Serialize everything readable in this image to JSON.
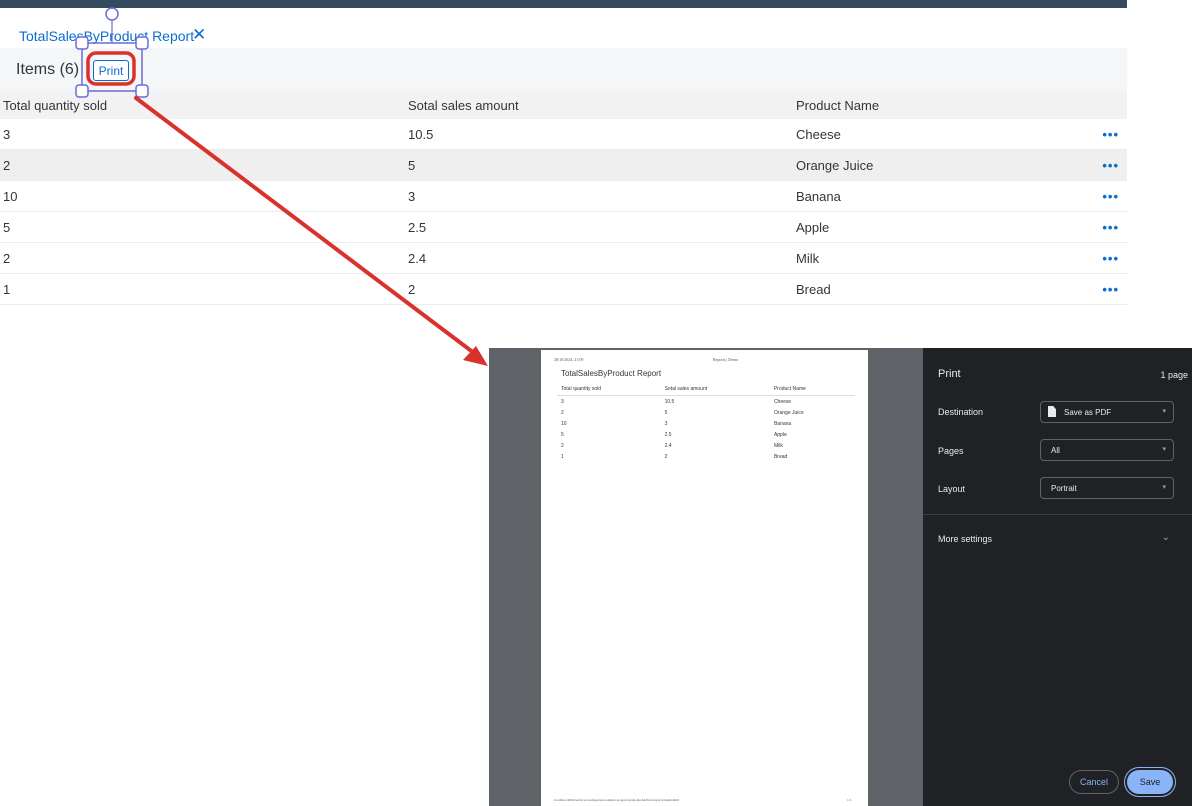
{
  "app": {
    "tab": {
      "label": "TotalSalesByProduct Report",
      "close_icon": "close-icon"
    },
    "toolbar": {
      "items_title": "Items (6)",
      "print_label": "Print"
    },
    "table": {
      "headers": [
        "Total quantity sold",
        "Sotal sales amount",
        "Product Name"
      ],
      "rows": [
        [
          "3",
          "10.5",
          "Cheese"
        ],
        [
          "2",
          "5",
          "Orange Juice"
        ],
        [
          "10",
          "3",
          "Banana"
        ],
        [
          "5",
          "2.5",
          "Apple"
        ],
        [
          "2",
          "2.4",
          "Milk"
        ],
        [
          "1",
          "2",
          "Bread"
        ]
      ],
      "row_action_icon": "more-horizontal-icon",
      "row_action_glyph": "•••"
    },
    "colors": {
      "shell": "#354a5f",
      "accent": "#0a6ed1",
      "annotation": "#d9322c"
    }
  },
  "print_preview": {
    "header_left": "28/10/2024, 21:09",
    "header_center": "Reports | Demo",
    "title": "TotalSalesByProduct Report",
    "headers": [
      "Total quantity sold",
      "Sotal sales amount",
      "Product Name"
    ],
    "rows": [
      [
        "3",
        "10.5",
        "Cheese"
      ],
      [
        "2",
        "5",
        "Orange Juice"
      ],
      [
        "10",
        "3",
        "Banana"
      ],
      [
        "5",
        "2.5",
        "Apple"
      ],
      [
        "2",
        "2.4",
        "Milk"
      ],
      [
        "1",
        "2",
        "Bread"
      ]
    ],
    "footer_left": "localhost:4004/services/webapp/test-sample-projects/print-model/fiori/reports/index.html",
    "footer_right": "1/1"
  },
  "print_panel": {
    "title": "Print",
    "page_count": "1 page",
    "destination_label": "Destination",
    "destination_value": "Save as PDF",
    "pages_label": "Pages",
    "pages_value": "All",
    "layout_label": "Layout",
    "layout_value": "Portrait",
    "more_settings_label": "More settings",
    "cancel_label": "Cancel",
    "save_label": "Save",
    "colors": {
      "panel": "#202124",
      "accent": "#8ab4f8"
    }
  }
}
